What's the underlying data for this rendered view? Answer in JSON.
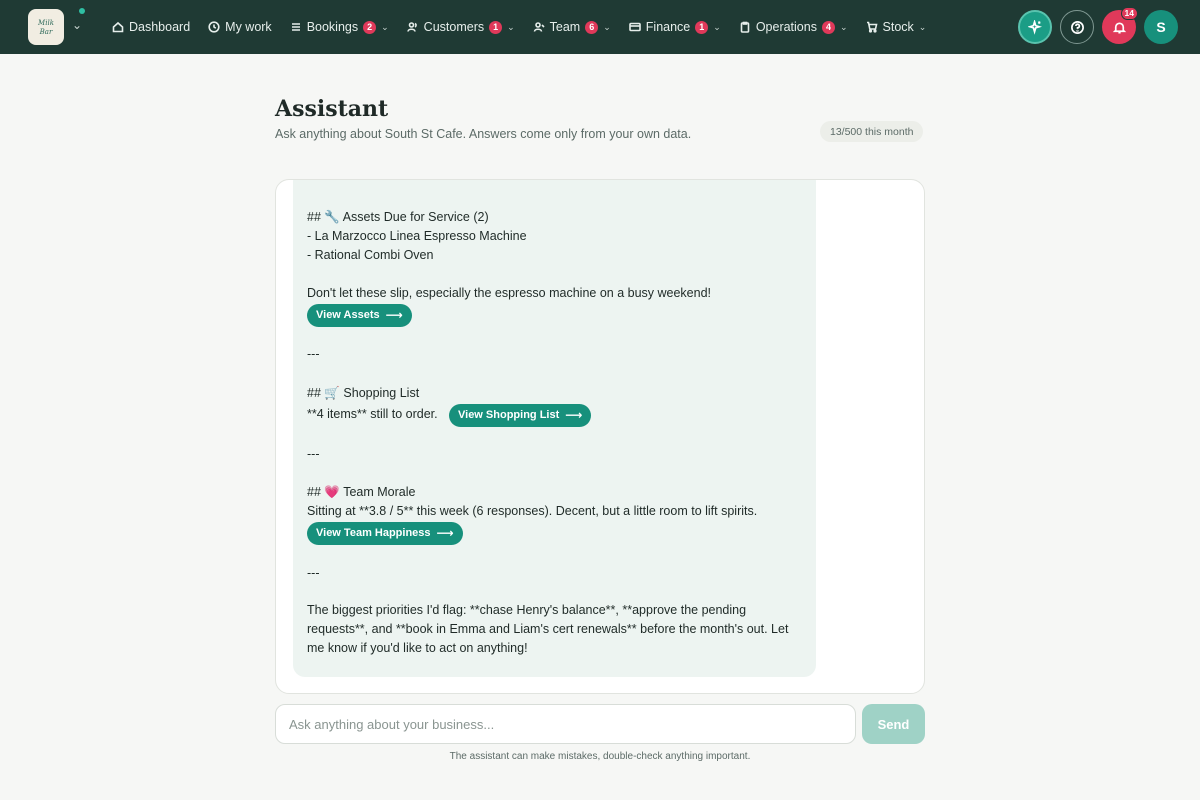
{
  "nav": {
    "brand": {
      "logo_text": "Milk Bar Cafe"
    },
    "items": [
      {
        "label": "Dashboard",
        "icon": "home-icon"
      },
      {
        "label": "My work",
        "icon": "clock-icon"
      },
      {
        "label": "Bookings",
        "icon": "list-icon",
        "badge": "2",
        "dropdown": true
      },
      {
        "label": "Customers",
        "icon": "users-icon",
        "badge": "1",
        "dropdown": true
      },
      {
        "label": "Team",
        "icon": "team-icon",
        "badge": "6",
        "dropdown": true
      },
      {
        "label": "Finance",
        "icon": "card-icon",
        "badge": "1",
        "dropdown": true
      },
      {
        "label": "Operations",
        "icon": "clipboard-icon",
        "badge": "4",
        "dropdown": true
      },
      {
        "label": "Stock",
        "icon": "cart-icon",
        "dropdown": true
      }
    ],
    "notifications_count": "14",
    "avatar_initial": "S"
  },
  "header": {
    "title": "Assistant",
    "subtitle": "Ask anything about South St Cafe. Answers come only from your own data.",
    "usage": "13/500 this month"
  },
  "message": {
    "lines": [
      "---",
      "## 🔧 Assets Due for Service (2)",
      "- La Marzocco Linea Espresso Machine",
      "- Rational Combi Oven",
      "Don't let these slip, especially the espresso machine on a busy weekend!",
      "---",
      "## 🛒 Shopping List",
      "**4 items** still to order.",
      "---",
      "## 💗 Team Morale",
      "Sitting at **3.8 / 5** this week (6 responses). Decent, but a little room to lift spirits.",
      "---",
      "The biggest priorities I'd flag: **chase Henry's balance**, **approve the pending",
      "requests**, and **book in Emma and Liam's cert renewals** before the month's out. Let",
      "me know if you'd like to act on anything!"
    ],
    "buttons": {
      "assets": "View Assets",
      "shopping": "View Shopping List",
      "happiness": "View Team Happiness"
    }
  },
  "composer": {
    "placeholder": "Ask anything about your business...",
    "send_label": "Send",
    "disclaimer": "The assistant can make mistakes, double-check anything important."
  },
  "colors": {
    "nav_bg": "#1f3a34",
    "accent": "#17907c",
    "badge": "#e0395a",
    "bubble_bg": "#edf4f1"
  }
}
